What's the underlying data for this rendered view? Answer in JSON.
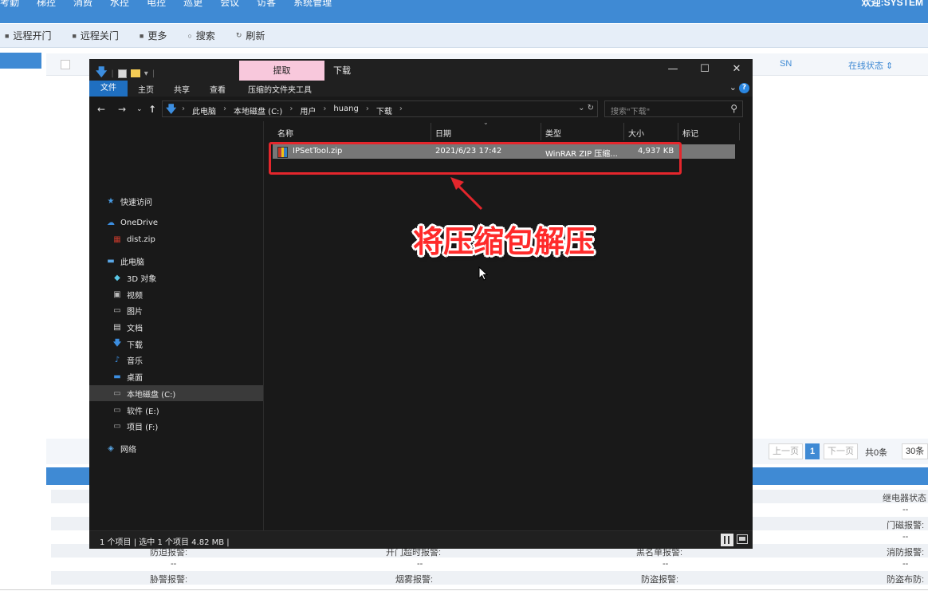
{
  "webapp": {
    "menu": [
      "考勤",
      "梯控",
      "消费",
      "水控",
      "电控",
      "巡更",
      "会议",
      "访客",
      "系统管理"
    ],
    "welcome": "欢迎:SYSTEM",
    "toolbar": [
      {
        "label": "远程开门",
        "icon": "door-icon"
      },
      {
        "label": "远程关门",
        "icon": "door-icon"
      },
      {
        "label": "更多",
        "icon": "more-icon"
      },
      {
        "label": "搜索",
        "icon": "search-icon"
      },
      {
        "label": "刷新",
        "icon": "refresh-icon"
      }
    ],
    "grid": {
      "col_sn": "SN",
      "col_online": "在线状态 ⇕"
    },
    "pager": {
      "prev": "上一页",
      "current": "1",
      "next": "下一页",
      "total": "共0条",
      "page_size": "30条"
    },
    "detail": {
      "relay_status": "继电器状态",
      "dash": "--",
      "door_alarm": "门磁报警:",
      "antipass": "防迫报警:",
      "open_timeout": "开门超时报警:",
      "blacklist": "黑名单报警:",
      "fire": "消防报警:",
      "duress": "胁警报警:",
      "smoke": "烟雾报警:",
      "theft": "防盗报警:",
      "theft_arm": "防盗布防:"
    }
  },
  "explorer": {
    "title": "下载",
    "context_tab": "提取",
    "ribbon": {
      "file": "文件",
      "home": "主页",
      "share": "共享",
      "view": "查看",
      "zip_tools": "压缩的文件夹工具"
    },
    "breadcrumbs": [
      "此电脑",
      "本地磁盘 (C:)",
      "用户",
      "huang",
      "下载"
    ],
    "search_placeholder": "搜索\"下载\"",
    "nav": {
      "quick_access": "快速访问",
      "onedrive": "OneDrive",
      "distzip": "dist.zip",
      "this_pc": "此电脑",
      "objects3d": "3D 对象",
      "videos": "视频",
      "pictures": "图片",
      "documents": "文档",
      "downloads": "下载",
      "music": "音乐",
      "desktop": "桌面",
      "local_c": "本地磁盘 (C:)",
      "soft_e": "软件 (E:)",
      "proj_f": "项目 (F:)",
      "network": "网络"
    },
    "columns": {
      "name": "名称",
      "date": "日期",
      "type": "类型",
      "size": "大小",
      "tag": "标记"
    },
    "files": [
      {
        "name": "IPSetTool.zip",
        "date": "2021/6/23 17:42",
        "type": "WinRAR ZIP 压缩...",
        "size": "4,937 KB"
      }
    ],
    "status": "1 个项目  |  选中 1 个项目 4.82 MB  |"
  },
  "annotation": {
    "text": "将压缩包解压",
    "color": "#ff2a2a"
  },
  "colors": {
    "accent": "#3f8ad4",
    "highlight_border": "#e4262c"
  }
}
